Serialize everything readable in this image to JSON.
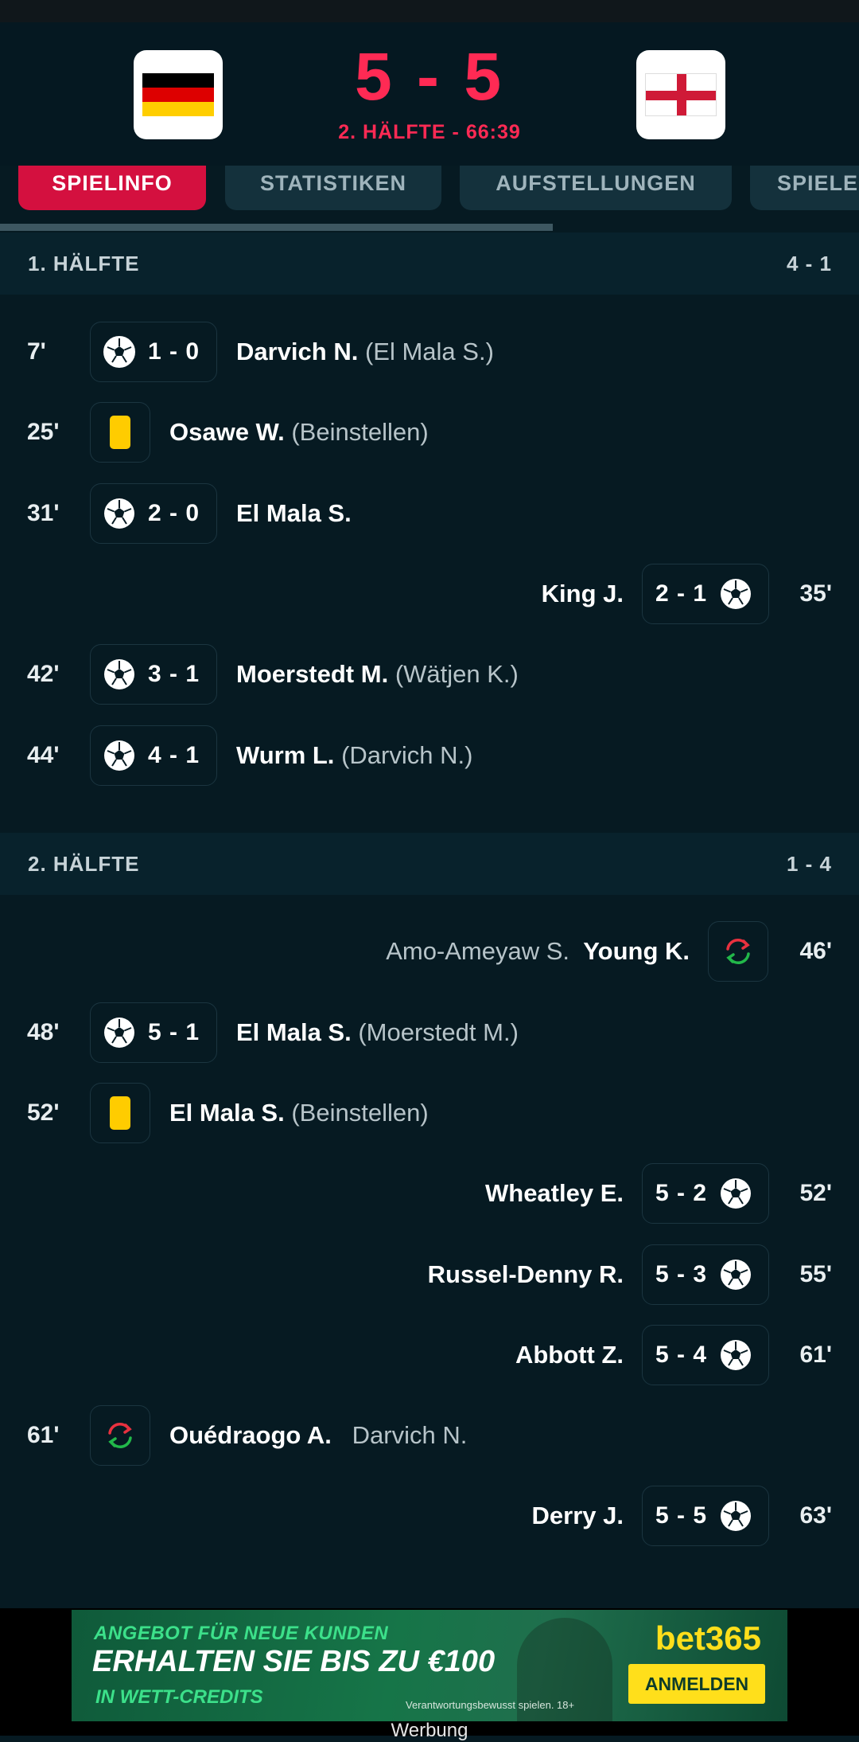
{
  "header": {
    "score": "5 - 5",
    "period": "2. HÄLFTE - 66:39",
    "home_flag": "flag-germany-icon",
    "away_flag": "flag-england-icon"
  },
  "tabs": [
    {
      "label": "SPIELINFO",
      "active": true
    },
    {
      "label": "STATISTIKEN",
      "active": false
    },
    {
      "label": "AUFSTELLUNGEN",
      "active": false
    },
    {
      "label": "SPIELE",
      "active": false
    }
  ],
  "sections": [
    {
      "title": "1. HÄLFTE",
      "score": "4 - 1"
    },
    {
      "title": "2. HÄLFTE",
      "score": "1 - 4"
    }
  ],
  "events": [
    {
      "minute": "7'",
      "side": "home",
      "type": "goal",
      "score": "1 - 0",
      "player": "Darvich N.",
      "extra": "(El Mala S.)"
    },
    {
      "minute": "25'",
      "side": "home",
      "type": "yellow-card",
      "player": "Osawe W.",
      "extra": "(Beinstellen)"
    },
    {
      "minute": "31'",
      "side": "home",
      "type": "goal",
      "score": "2 - 0",
      "player": "El Mala S.",
      "extra": ""
    },
    {
      "minute": "35'",
      "side": "away",
      "type": "goal",
      "score": "2 - 1",
      "player": "King J.",
      "extra": ""
    },
    {
      "minute": "42'",
      "side": "home",
      "type": "goal",
      "score": "3 - 1",
      "player": "Moerstedt M.",
      "extra": "(Wätjen K.)"
    },
    {
      "minute": "44'",
      "side": "home",
      "type": "goal",
      "score": "4 - 1",
      "player": "Wurm L.",
      "extra": "(Darvich N.)"
    },
    {
      "minute": "46'",
      "side": "away",
      "type": "substitution",
      "player": "Young K.",
      "extra": "Amo-Ameyaw S."
    },
    {
      "minute": "48'",
      "side": "home",
      "type": "goal",
      "score": "5 - 1",
      "player": "El Mala S.",
      "extra": "(Moerstedt M.)"
    },
    {
      "minute": "52'",
      "side": "home",
      "type": "yellow-card",
      "player": "El Mala S.",
      "extra": "(Beinstellen)"
    },
    {
      "minute": "52'",
      "side": "away",
      "type": "goal",
      "score": "5 - 2",
      "player": "Wheatley E.",
      "extra": ""
    },
    {
      "minute": "55'",
      "side": "away",
      "type": "goal",
      "score": "5 - 3",
      "player": "Russel-Denny R.",
      "extra": ""
    },
    {
      "minute": "61'",
      "side": "away",
      "type": "goal",
      "score": "5 - 4",
      "player": "Abbott Z.",
      "extra": ""
    },
    {
      "minute": "61'",
      "side": "home",
      "type": "substitution",
      "player": "Ouédraogo A.",
      "extra": "Darvich N."
    },
    {
      "minute": "63'",
      "side": "away",
      "type": "goal",
      "score": "5 - 5",
      "player": "Derry J.",
      "extra": ""
    }
  ],
  "ad": {
    "line1": "ANGEBOT FÜR NEUE KUNDEN",
    "line2": "ERHALTEN SIE BIS ZU €100",
    "line3": "IN WETT-CREDITS",
    "brand": "bet365",
    "button": "ANMELDEN",
    "disclaimer": "Verantwortungsbewusst spielen. 18+",
    "label": "Werbung"
  },
  "colors": {
    "accent": "#ff2a54",
    "active_tab": "#d4103f",
    "background": "#061a22",
    "yellow_card": "#ffcc00"
  }
}
